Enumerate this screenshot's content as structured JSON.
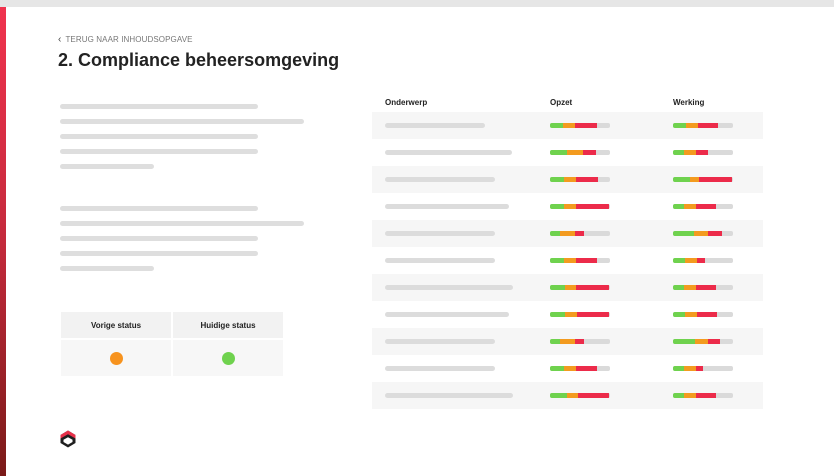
{
  "nav": {
    "back_label": "TERUG NAAR INHOUDSOPGAVE"
  },
  "page": {
    "title": "2. Compliance beheersomgeving"
  },
  "colors": {
    "accent": "#e8304a",
    "green": "#6fd24e",
    "orange": "#f39b1f",
    "red": "#ec2b4a",
    "track": "#dadada"
  },
  "status_table": {
    "headers": [
      "Vorige status",
      "Huidige status"
    ],
    "values": [
      {
        "status": "orange",
        "color": "#f7931e"
      },
      {
        "status": "green",
        "color": "#6fd24e"
      }
    ]
  },
  "table": {
    "headers": {
      "subject": "Onderwerp",
      "opzet": "Opzet",
      "werking": "Werking"
    },
    "rows": [
      {
        "subject_fill": 0.78,
        "opzet": [
          0.22,
          0.19,
          0.37
        ],
        "werking": [
          0.22,
          0.2,
          0.33
        ]
      },
      {
        "subject_fill": 0.99,
        "opzet": [
          0.28,
          0.27,
          0.22
        ],
        "werking": [
          0.18,
          0.2,
          0.2
        ]
      },
      {
        "subject_fill": 0.86,
        "opzet": [
          0.23,
          0.2,
          0.37
        ],
        "werking": [
          0.28,
          0.16,
          0.55
        ]
      },
      {
        "subject_fill": 0.97,
        "opzet": [
          0.23,
          0.2,
          0.55
        ],
        "werking": [
          0.18,
          0.2,
          0.33
        ]
      },
      {
        "subject_fill": 0.86,
        "opzet": [
          0.17,
          0.25,
          0.14
        ],
        "werking": [
          0.35,
          0.23,
          0.23
        ]
      },
      {
        "subject_fill": 0.86,
        "opzet": [
          0.23,
          0.2,
          0.35
        ],
        "werking": [
          0.2,
          0.2,
          0.13
        ]
      },
      {
        "subject_fill": 1.0,
        "opzet": [
          0.25,
          0.18,
          0.55
        ],
        "werking": [
          0.18,
          0.2,
          0.33
        ]
      },
      {
        "subject_fill": 0.97,
        "opzet": [
          0.25,
          0.2,
          0.53
        ],
        "werking": [
          0.2,
          0.2,
          0.33
        ]
      },
      {
        "subject_fill": 0.86,
        "opzet": [
          0.17,
          0.25,
          0.14
        ],
        "werking": [
          0.37,
          0.22,
          0.2
        ]
      },
      {
        "subject_fill": 0.86,
        "opzet": [
          0.23,
          0.2,
          0.35
        ],
        "werking": [
          0.18,
          0.2,
          0.12
        ]
      },
      {
        "subject_fill": 1.0,
        "opzet": [
          0.28,
          0.18,
          0.52
        ],
        "werking": [
          0.18,
          0.2,
          0.33
        ]
      }
    ]
  }
}
